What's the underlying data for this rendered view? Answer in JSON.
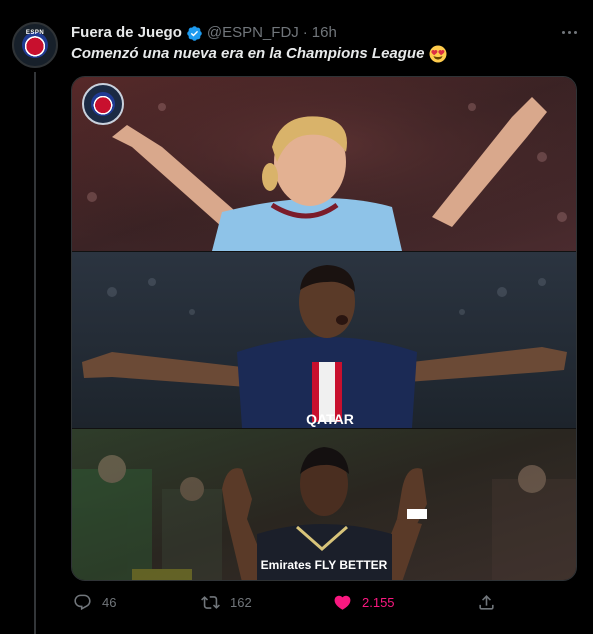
{
  "tweet": {
    "author": {
      "display_name": "Fuera de Juego",
      "handle": "@ESPN_FDJ",
      "separator": "·",
      "time": "16h",
      "avatar_text": "ESPN",
      "verified_icon": "verified-badge-icon"
    },
    "text": "Comenzó una nueva era en la Champions League",
    "text_emoji": "heart-eyes-emoji-icon",
    "media": {
      "panels": [
        {
          "name": "media-panel-1",
          "description_icon": "player-celebration-photo"
        },
        {
          "name": "media-panel-2",
          "jersey_text": "QATAR",
          "description_icon": "player-celebration-photo"
        },
        {
          "name": "media-panel-3",
          "jersey_text": "Emirates FLY BETTER",
          "description_icon": "player-celebration-photo"
        }
      ]
    },
    "actions": {
      "reply_count": "46",
      "retweet_count": "162",
      "like_count": "2.155",
      "like_color": "#f91880"
    }
  },
  "colors": {
    "background": "#000000",
    "text_primary": "#e7e9ea",
    "text_secondary": "#71767b",
    "verified": "#1d9bf0",
    "like": "#f91880"
  }
}
